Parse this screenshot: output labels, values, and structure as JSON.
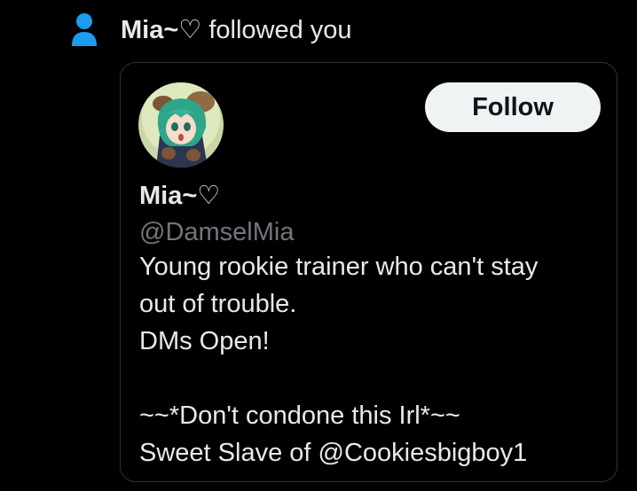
{
  "notification": {
    "icon": "person-icon",
    "actor_name": "Mia~♡",
    "action_text": "followed you"
  },
  "profile_card": {
    "avatar": "anime-avatar",
    "follow_label": "Follow",
    "display_name": "Mia~♡",
    "handle": "@DamselMia",
    "bio_lines": [
      "Young rookie trainer who can't stay",
      "out of trouble.",
      "DMs Open!",
      "",
      "~~*Don't condone this Irl*~~",
      "Sweet Slave of @Cookiesbigboy1"
    ]
  },
  "colors": {
    "background": "#000000",
    "accent": "#1d9bf0",
    "text": "#e7e9ea",
    "muted": "#71767b",
    "border": "#2f3336",
    "button_bg": "#eff3f4"
  }
}
